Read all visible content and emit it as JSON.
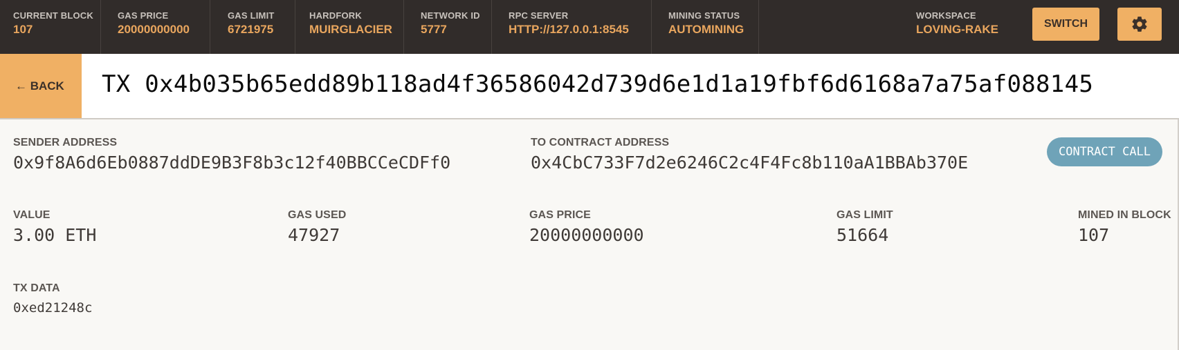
{
  "topbar": {
    "stats": [
      {
        "label": "CURRENT BLOCK",
        "value": "107"
      },
      {
        "label": "GAS PRICE",
        "value": "20000000000"
      },
      {
        "label": "GAS LIMIT",
        "value": "6721975"
      },
      {
        "label": "HARDFORK",
        "value": "MUIRGLACIER"
      },
      {
        "label": "NETWORK ID",
        "value": "5777"
      },
      {
        "label": "RPC SERVER",
        "value": "HTTP://127.0.0.1:8545"
      },
      {
        "label": "MINING STATUS",
        "value": "AUTOMINING"
      }
    ],
    "workspace": {
      "label": "WORKSPACE",
      "value": "LOVING-RAKE"
    },
    "switch_label": "SWITCH",
    "settings_icon": "gear-icon"
  },
  "titlebar": {
    "back_label": "← BACK",
    "tx_title": "TX 0x4b035b65edd89b118ad4f36586042d739d6e1d1a19fbf6d6168a7a75af088145"
  },
  "details": {
    "sender": {
      "label": "SENDER ADDRESS",
      "value": "0x9f8A6d6Eb0887ddDE9B3F8b3c12f40BBCCeCDFf0"
    },
    "to_contract": {
      "label": "TO CONTRACT ADDRESS",
      "value": "0x4CbC733F7d2e6246C2c4F4Fc8b110aA1BBAb370E"
    },
    "badge": "CONTRACT CALL",
    "value": {
      "label": "VALUE",
      "value": "3.00 ETH"
    },
    "gas_used": {
      "label": "GAS USED",
      "value": "47927"
    },
    "gas_price": {
      "label": "GAS PRICE",
      "value": "20000000000"
    },
    "gas_limit": {
      "label": "GAS LIMIT",
      "value": "51664"
    },
    "mined_in_block": {
      "label": "MINED IN BLOCK",
      "value": "107"
    },
    "tx_data": {
      "label": "TX DATA",
      "value": "0xed21248c"
    }
  },
  "colors": {
    "topbar_bg": "#312c2a",
    "accent": "#f0b064",
    "stat_value": "#e9a65e",
    "badge": "#6fa3b8",
    "page_bg": "#f9f8f5"
  }
}
